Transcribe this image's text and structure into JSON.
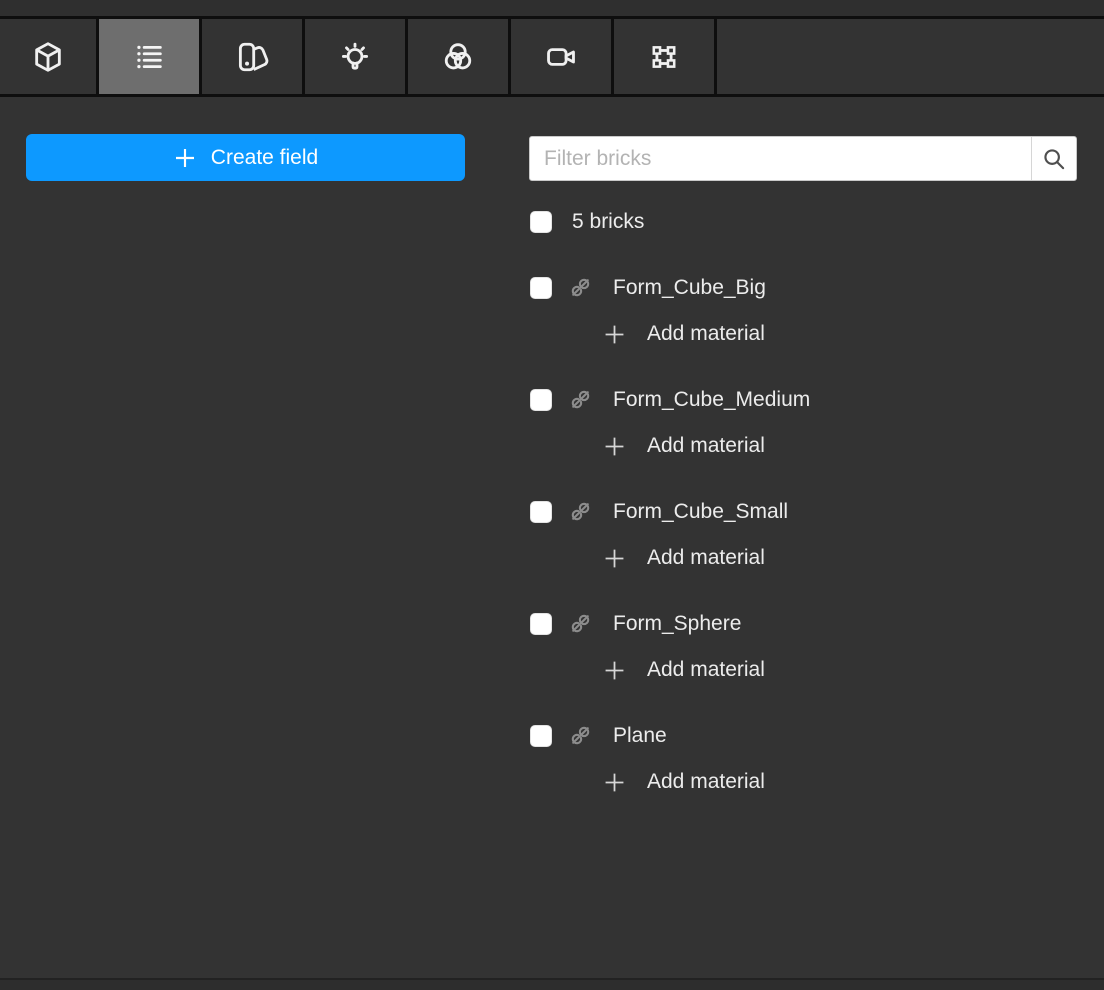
{
  "toolbar": {
    "tabs": [
      {
        "id": "3d-view",
        "icon": "cube-3d-icon",
        "selected": false
      },
      {
        "id": "bricks",
        "icon": "list-icon",
        "selected": true
      },
      {
        "id": "materials",
        "icon": "swatches-icon",
        "selected": false
      },
      {
        "id": "lighting",
        "icon": "lightbulb-icon",
        "selected": false
      },
      {
        "id": "blend",
        "icon": "overlap-circles-icon",
        "selected": false
      },
      {
        "id": "camera",
        "icon": "video-camera-icon",
        "selected": false
      },
      {
        "id": "frame",
        "icon": "selection-frame-icon",
        "selected": false
      }
    ]
  },
  "actions": {
    "create_field_label": "Create field"
  },
  "filter": {
    "placeholder": "Filter bricks",
    "value": "",
    "icon": "magnifier-icon"
  },
  "bricks": {
    "summary_label": "5 bricks",
    "count": 5,
    "items": [
      {
        "name": "Form_Cube_Big",
        "linked": false,
        "add_label": "Add material"
      },
      {
        "name": "Form_Cube_Medium",
        "linked": false,
        "add_label": "Add material"
      },
      {
        "name": "Form_Cube_Small",
        "linked": false,
        "add_label": "Add material"
      },
      {
        "name": "Form_Sphere",
        "linked": false,
        "add_label": "Add material"
      },
      {
        "name": "Plane",
        "linked": false,
        "add_label": "Add material"
      }
    ]
  },
  "colors": {
    "background": "#333333",
    "accent_blue": "#0d99ff",
    "tab_selected": "#6e6e6e",
    "icon": "#f0f0f0",
    "unlink_icon": "#8c8c8c",
    "text": "#ececec"
  }
}
